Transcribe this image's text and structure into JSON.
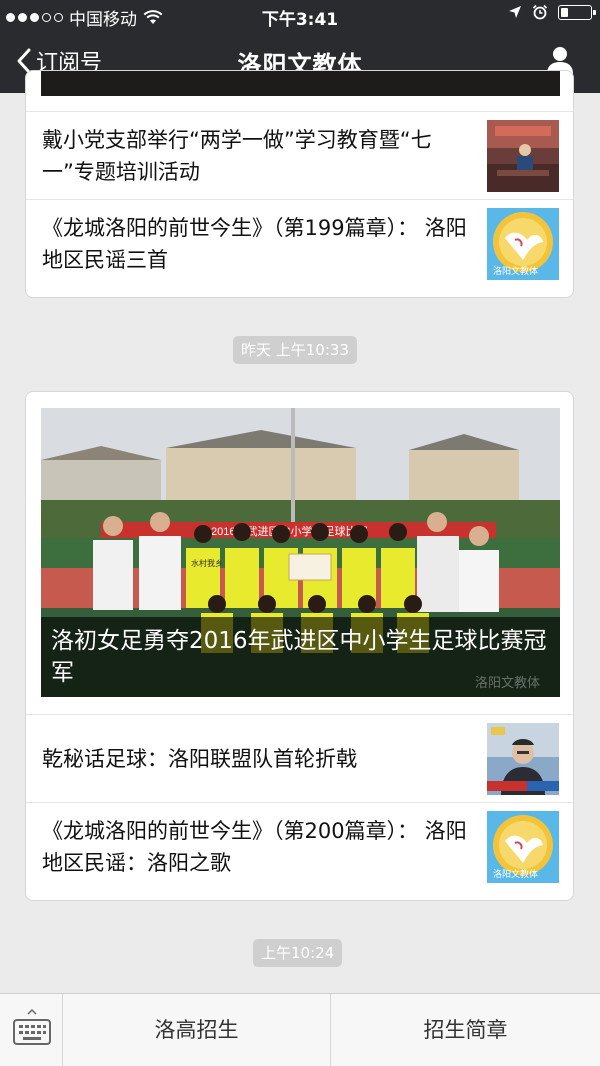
{
  "status_bar": {
    "carrier": "中国移动",
    "time": "下午3:41"
  },
  "nav": {
    "back_label": "订阅号",
    "title": "洛阳文教体"
  },
  "card1": {
    "items": [
      {
        "title": "戴小党支部举行“两学一做”学习教育暨“七一”专题培训活动"
      },
      {
        "title": "《龙城洛阳的前世今生》（第199篇章）： 洛阳地区民谣三首",
        "thumb_watermark": "洛阳文教体"
      }
    ]
  },
  "timestamp1": "昨天 上午10:33",
  "card2": {
    "hero": {
      "caption": "洛初女足勇夺2016年武进区中小学生足球比赛冠军",
      "banner_text": "2016年武进区中小学生足球比赛",
      "jersey_text": "水村我乡",
      "watermark": "洛阳文教体"
    },
    "items": [
      {
        "title": "乾秘话足球：洛阳联盟队首轮折戟"
      },
      {
        "title": "《龙城洛阳的前世今生》（第200篇章）： 洛阳地区民谣：洛阳之歌",
        "thumb_watermark": "洛阳文教体"
      }
    ]
  },
  "timestamp2": "上午10:24",
  "bottom_bar": {
    "keyboard_icon": "keyboard-icon",
    "menus": [
      "洛高招生",
      "招生简章"
    ]
  },
  "colors": {
    "bar_bg": "#2a2b2f",
    "page_bg": "#ebebeb",
    "timestamp_bg": "#cfcfcf"
  }
}
